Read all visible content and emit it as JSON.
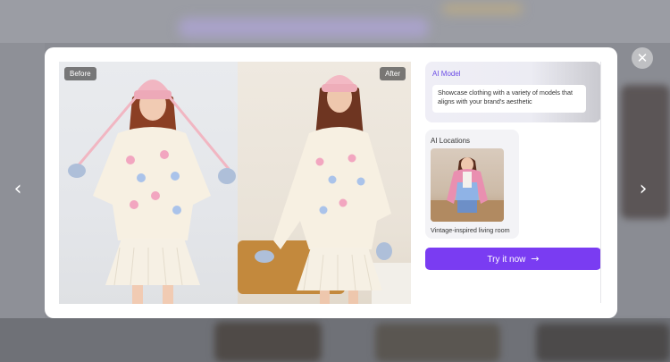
{
  "nav": {
    "prev_icon": "‹",
    "next_icon": "›",
    "close_icon": "✕"
  },
  "compare": {
    "before_label": "Before",
    "after_label": "After"
  },
  "panel": {
    "ai_model": {
      "title": "AI Model",
      "description": "Showcase clothing with a variety of models that aligns with your brand's aesthetic"
    },
    "ai_locations": {
      "title": "AI Locations",
      "caption": "Vintage-inspired living room"
    },
    "cta": {
      "label": "Try it now",
      "icon": "→"
    }
  },
  "colors": {
    "accent": "#7a3cf2",
    "ai_model_title": "#6b4de6",
    "overlay": "#7d7f86"
  }
}
